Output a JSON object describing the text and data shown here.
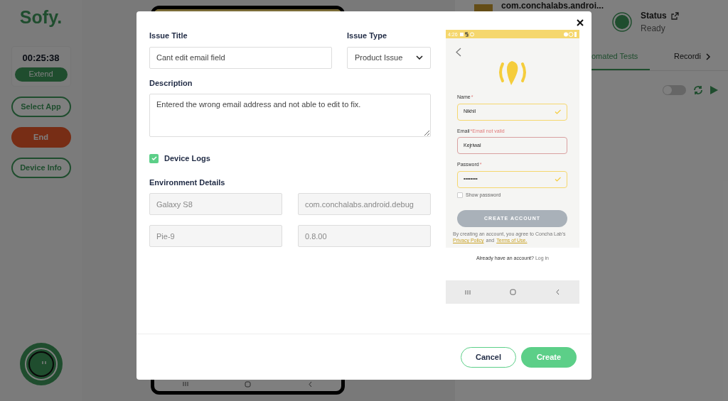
{
  "sidebar": {
    "logo": "Sofy.",
    "timer": "00:25:38",
    "extend_button": "Extend",
    "buttons": [
      {
        "label": "Select App",
        "kind": "outline"
      },
      {
        "label": "End",
        "kind": "danger"
      },
      {
        "label": "Device Info",
        "kind": "outline"
      }
    ]
  },
  "header": {
    "app_name": "com.conchalabs.androi...",
    "status_label": "Status",
    "status_value": "Ready"
  },
  "tabs": [
    {
      "label": "omated Tests",
      "selected": true
    },
    {
      "label": "Recordi",
      "selected": false
    }
  ],
  "toolbar": {
    "toggle_on": false
  },
  "dialog": {
    "issue_title": {
      "label": "Issue Title",
      "value": "Cant edit email field"
    },
    "issue_type": {
      "label": "Issue Type",
      "value": "Product Issue"
    },
    "description": {
      "label": "Description",
      "value": "Entered the wrong email address and not able to edit to fix."
    },
    "device_logs": {
      "label": "Device Logs",
      "checked": true
    },
    "environment": {
      "label": "Environment Details",
      "fields": [
        "Galaxy S8",
        "com.conchalabs.android.debug",
        "Pie-9",
        "0.8.00"
      ]
    },
    "screenshot": {
      "time": "4:26",
      "fields": [
        {
          "label": "Name",
          "mark": "*",
          "value": "Nikhil",
          "valid": true
        },
        {
          "label": "Email",
          "mark": "*Email not valid",
          "value": "Kejriwal",
          "valid": false
        },
        {
          "label": "Password",
          "mark": "*",
          "value": "••••••••",
          "valid": true
        }
      ],
      "show_password": {
        "label": "Show password",
        "checked": false
      },
      "button": "CREATE ACCOUNT",
      "terms": "By creating an account, you agree to Concha Lab's",
      "privacy_link": "Privacy Policy",
      "and": "and",
      "terms_link": "Terms of Use.",
      "login_prompt": "Already have an account?",
      "login_link": "Log in"
    },
    "cancel_button": "Cancel",
    "create_button": "Create"
  }
}
